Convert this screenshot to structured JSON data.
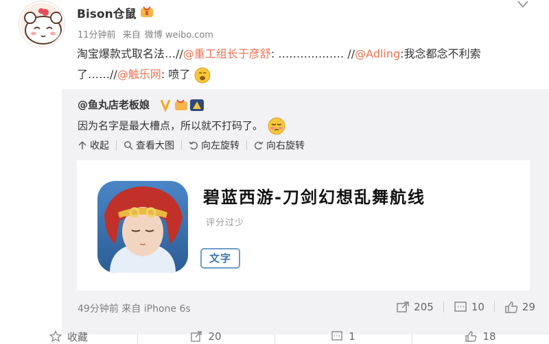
{
  "post": {
    "author": "Bison仓鼠",
    "time": "11分钟前",
    "source_prefix": "来自",
    "source": "微博 weibo.com",
    "text_parts": [
      {
        "t": "淘宝爆款式取名法…//",
        "m": false
      },
      {
        "t": "@重工组长于彦舒",
        "m": true
      },
      {
        "t": ": ……………… //",
        "m": false
      },
      {
        "t": "@Adling",
        "m": true
      },
      {
        "t": ":我念都念不利索了……//",
        "m": false
      },
      {
        "t": "@触乐网",
        "m": true
      },
      {
        "t": ": 喷了",
        "m": false
      }
    ]
  },
  "repost": {
    "author": "@鱼丸店老板娘",
    "text": "因为名字是最大槽点，所以就不打码了。",
    "tools": {
      "collapse": "收起",
      "view_large": "查看大图",
      "rotate_left": "向左旋转",
      "rotate_right": "向右旋转"
    },
    "app_card": {
      "title": "碧蓝西游-刀剑幻想乱舞航线",
      "rating": "评分过少",
      "tag": "文字"
    },
    "time": "49分钟前",
    "source_prefix": "来自",
    "source": "iPhone 6s",
    "reposts": "205",
    "comments": "10",
    "likes": "29"
  },
  "bottom_bar": {
    "favorite": "收藏",
    "repost": "20",
    "comment": "1",
    "like": "18"
  },
  "colors": {
    "mention": "#eb7350",
    "repost_bg": "#f2f2f5",
    "tag_border": "#6e9cc9",
    "vip_gold": "#f5a623"
  },
  "icons": {
    "collapse": "arrow-up-icon",
    "view_large": "magnifier-icon",
    "rotate_left": "rotate-left-icon",
    "rotate_right": "rotate-right-icon",
    "repost": "share-icon",
    "comment": "comment-icon",
    "like": "thumb-up-icon",
    "favorite": "star-icon"
  }
}
